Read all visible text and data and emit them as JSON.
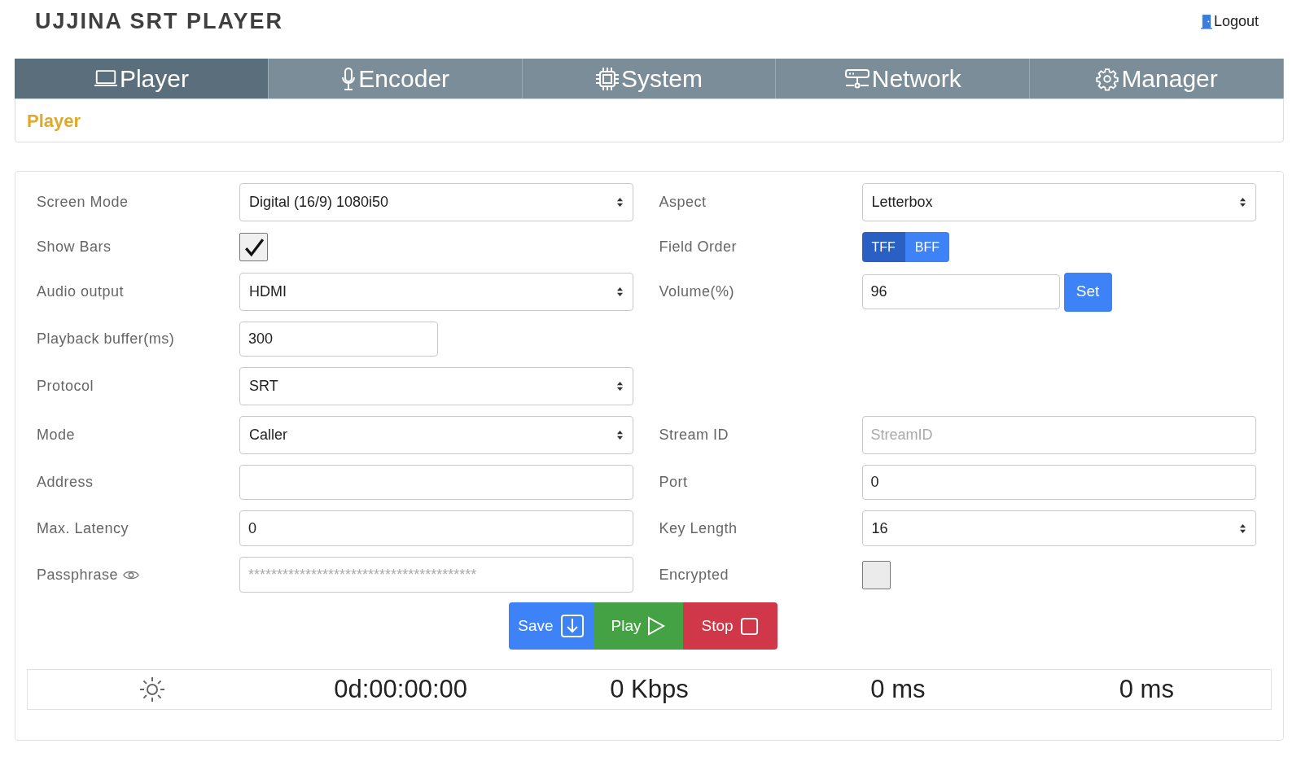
{
  "header": {
    "title": "UJJINA SRT PLAYER",
    "logout": "Logout"
  },
  "tabs": [
    {
      "label": "Player",
      "kind": "laptop",
      "selected": true
    },
    {
      "label": "Encoder",
      "kind": "mic",
      "selected": false
    },
    {
      "label": "System",
      "kind": "chip",
      "selected": false
    },
    {
      "label": "Network",
      "kind": "network",
      "selected": false
    },
    {
      "label": "Manager",
      "kind": "gear",
      "selected": false
    }
  ],
  "section_title": "Player",
  "rows": [
    {
      "left": {
        "label": "Screen Mode",
        "kind": "select",
        "value": "Digital (16/9) 1080i50"
      },
      "right": {
        "label": "Aspect",
        "kind": "select",
        "value": "Letterbox"
      }
    },
    {
      "left": {
        "label": "Show Bars",
        "kind": "checkbox",
        "checked": true
      },
      "right": {
        "label": "Field Order",
        "kind": "toggle",
        "options": [
          {
            "label": "TFF",
            "selected": true
          },
          {
            "label": "BFF",
            "selected": false
          }
        ]
      }
    },
    {
      "left": {
        "label": "Audio output",
        "kind": "select",
        "value": "HDMI"
      },
      "right": {
        "label": "Volume(%)",
        "kind": "input_button",
        "value": "96",
        "button": "Set"
      }
    },
    {
      "left": {
        "label": "Playback buffer(ms)",
        "kind": "short_input",
        "value": "300"
      }
    },
    {
      "left": {
        "label": "Protocol",
        "kind": "select",
        "value": "SRT"
      }
    },
    {
      "left": {
        "label": "Mode",
        "kind": "select",
        "value": "Caller"
      },
      "right": {
        "label": "Stream ID",
        "kind": "input",
        "placeholder": "StreamID"
      }
    },
    {
      "left": {
        "label": "Address",
        "kind": "input"
      },
      "right": {
        "label": "Port",
        "kind": "input",
        "value": "0"
      }
    },
    {
      "left": {
        "label": "Max. Latency",
        "kind": "input",
        "value": "0"
      },
      "right": {
        "label": "Key Length",
        "kind": "select",
        "value": "16"
      }
    },
    {
      "left": {
        "label": "Passphrase",
        "kind": "password",
        "placeholder": "****************************************"
      },
      "right": {
        "label": "Encrypted",
        "kind": "checkbox",
        "checked": false
      }
    }
  ],
  "actions": [
    {
      "label": "Save",
      "kind": "save"
    },
    {
      "label": "Play",
      "kind": "play"
    },
    {
      "label": "Stop",
      "kind": "stop"
    }
  ],
  "status": {
    "uptime": "0d:00:00:00",
    "bitrate": "0 Kbps",
    "latency_1": "0 ms",
    "latency_2": "0 ms"
  }
}
